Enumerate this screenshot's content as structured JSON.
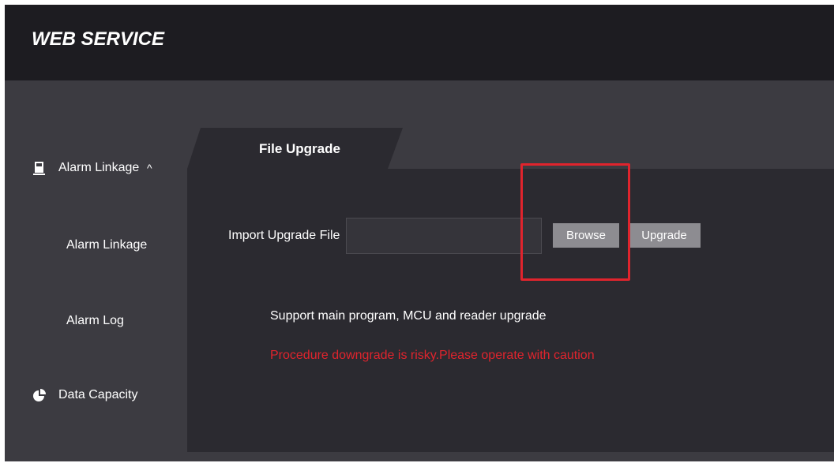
{
  "header": {
    "brand": "WEB SERVICE"
  },
  "sidebar": {
    "items": [
      {
        "label": "Alarm Linkage",
        "icon": "alarm-linkage-icon",
        "expanded": true,
        "chevron": "^"
      },
      {
        "label": "Alarm Linkage"
      },
      {
        "label": "Alarm Log"
      },
      {
        "label": "Data Capacity",
        "icon": "pie-chart-icon"
      }
    ]
  },
  "main": {
    "tab": {
      "label": "File Upgrade"
    },
    "import_label": "Import Upgrade File",
    "file_input": {
      "value": "",
      "placeholder": ""
    },
    "browse_label": "Browse",
    "upgrade_label": "Upgrade",
    "support_text": "Support main program, MCU and reader upgrade",
    "warning_text": "Procedure downgrade is risky.Please operate with caution"
  },
  "colors": {
    "header_bg": "#1d1c21",
    "app_bg": "#3c3b41",
    "panel_bg": "#2b2a30",
    "button_bg": "#8d8c91",
    "warning": "#e0242d",
    "highlight": "#e0242d"
  }
}
